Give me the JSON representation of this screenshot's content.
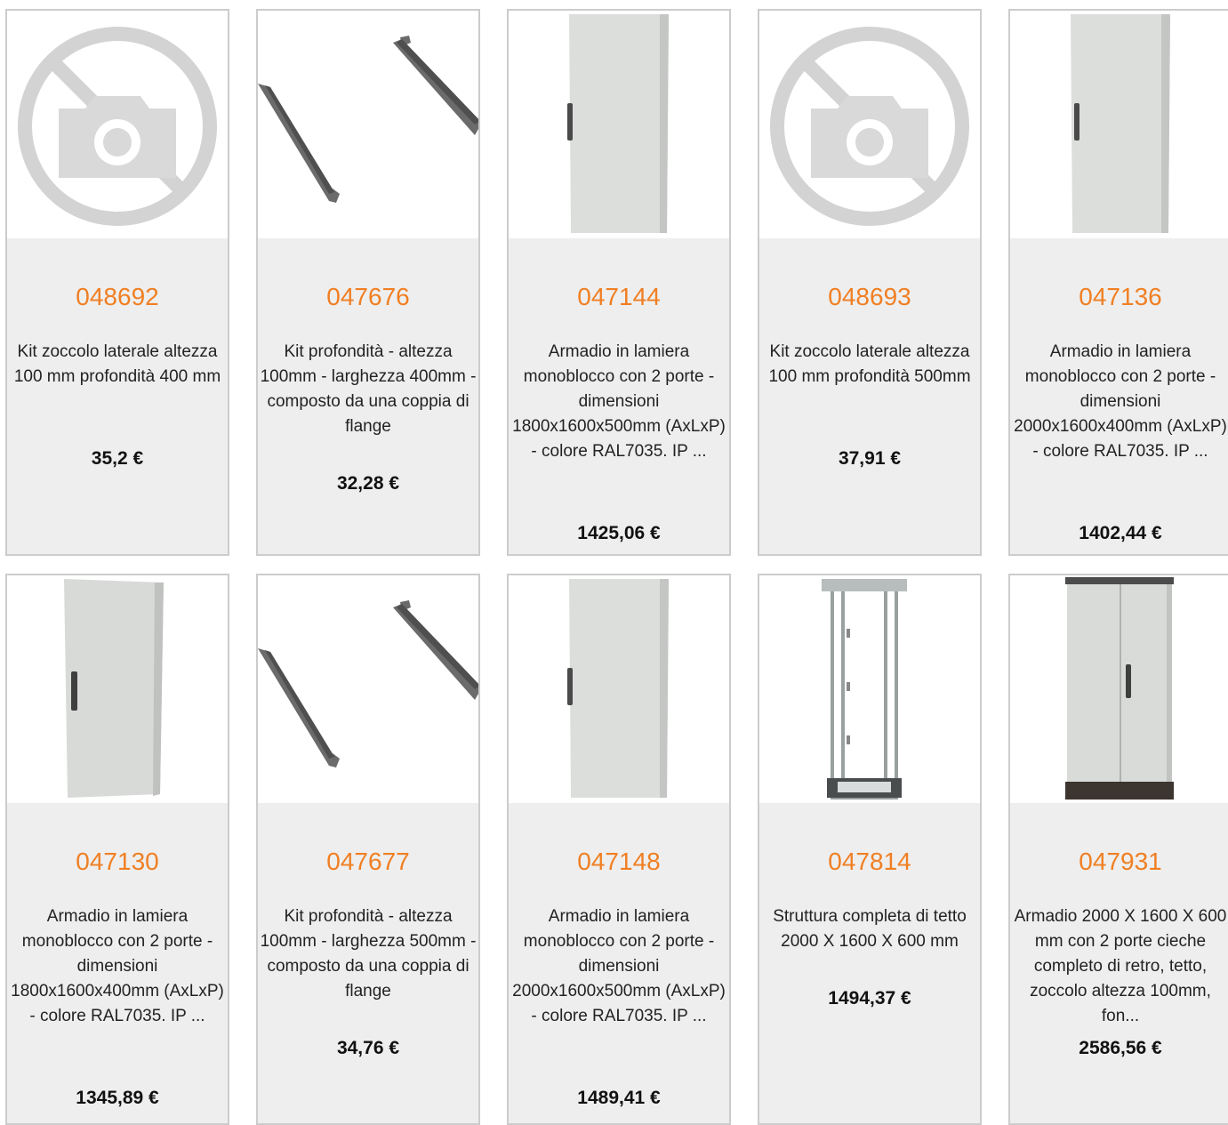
{
  "products": [
    {
      "code": "048692",
      "desc": "Kit zoccolo laterale altezza 100 mm profondità 400 mm",
      "price": "35,2 €",
      "image": "no-photo-icon"
    },
    {
      "code": "047676",
      "desc": "Kit profondità - altezza 100mm - larghezza 400mm - composto da una coppia di flange",
      "price": "32,28 €",
      "image": "flange-pair"
    },
    {
      "code": "047144",
      "desc": "Armadio in lamiera monoblocco con 2 porte - dimensioni 1800x1600x500mm (AxLxP) - colore RAL7035. IP ...",
      "price": "1425,06 €",
      "image": "cabinet-single-door"
    },
    {
      "code": "048693",
      "desc": "Kit zoccolo laterale altezza 100 mm profondità 500mm",
      "price": "37,91 €",
      "image": "no-photo-icon"
    },
    {
      "code": "047136",
      "desc": "Armadio in lamiera monoblocco con 2 porte - dimensioni 2000x1600x400mm (AxLxP) - colore RAL7035. IP ...",
      "price": "1402,44 €",
      "image": "cabinet-single-door"
    },
    {
      "code": "047130",
      "desc": "Armadio in lamiera monoblocco con 2 porte - dimensioni 1800x1600x400mm (AxLxP) - colore RAL7035. IP ...",
      "price": "1345,89 €",
      "image": "cabinet-single-door"
    },
    {
      "code": "047677",
      "desc": "Kit profondità - altezza 100mm - larghezza 500mm - composto da una coppia di flange",
      "price": "34,76 €",
      "image": "flange-pair"
    },
    {
      "code": "047148",
      "desc": "Armadio in lamiera monoblocco con 2 porte - dimensioni 2000x1600x500mm (AxLxP) - colore RAL7035. IP ...",
      "price": "1489,41 €",
      "image": "cabinet-single-door"
    },
    {
      "code": "047814",
      "desc": "Struttura completa di tetto 2000 X 1600 X 600 mm",
      "price": "1494,37 €",
      "image": "open-frame-rack"
    },
    {
      "code": "047931",
      "desc": "Armadio 2000 X 1600 X 600 mm con 2 porte cieche completo di retro, tetto, zoccolo altezza 100mm, fon...",
      "price": "2586,56 €",
      "image": "cabinet-double-door"
    }
  ],
  "colors": {
    "code": "#f07f23",
    "card_bg": "#eeeeee",
    "border": "#cccccc"
  }
}
